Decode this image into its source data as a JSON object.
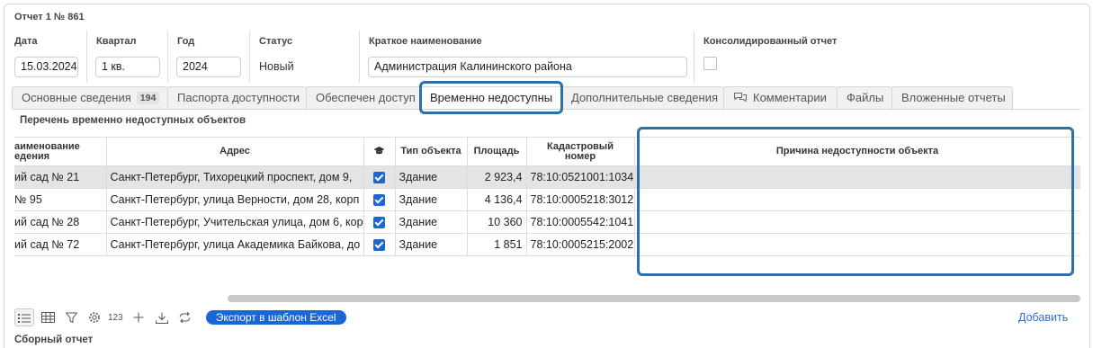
{
  "header": {
    "title": "Отчет 1 № 861",
    "fields": {
      "date_label": "Дата",
      "date_value": "15.03.2024",
      "quarter_label": "Квартал",
      "quarter_value": "1 кв.",
      "year_label": "Год",
      "year_value": "2024",
      "status_label": "Статус",
      "status_value": "Новый",
      "short_name_label": "Краткое наименование",
      "short_name_value": "Администрация Калининского района",
      "consolidated_label": "Консолидированный отчет"
    }
  },
  "tabs": [
    {
      "label": "Основные сведения",
      "badge": "194"
    },
    {
      "label": "Паспорта доступности"
    },
    {
      "label": "Обеспечен доступ"
    },
    {
      "label": "Временно недоступны",
      "active": true
    },
    {
      "label": "Дополнительные сведения"
    },
    {
      "label": "Комментарии",
      "icon": "comments-icon"
    },
    {
      "label": "Файлы"
    },
    {
      "label": "Вложенные отчеты"
    }
  ],
  "section": {
    "title": "Перечень временно недоступных объектов"
  },
  "table": {
    "columns": {
      "name_line1": "аименование",
      "name_line2": "едения",
      "address": "Адрес",
      "icon": "graduation-cap-icon",
      "object_type": "Тип объекта",
      "area": "Площадь",
      "cadastral_line1": "Кадастровый",
      "cadastral_line2": "номер",
      "reason": "Причина недоступности объекта"
    },
    "rows": [
      {
        "name": "ий сад № 21",
        "address": "Санкт-Петербург, Тихорецкий проспект, дом 9,",
        "checked": true,
        "type": "Здание",
        "area": "2 923,4",
        "cadastral": "78:10:0521001:1034",
        "reason": ""
      },
      {
        "name": "№ 95",
        "address": "Санкт-Петербург, улица Верности, дом 28, корп",
        "checked": true,
        "type": "Здание",
        "area": "4 136,4",
        "cadastral": "78:10:0005218:3012",
        "reason": ""
      },
      {
        "name": "ий сад № 28",
        "address": "Санкт-Петербург, Учительская улица, дом 6, кор",
        "checked": true,
        "type": "Здание",
        "area": "10 360",
        "cadastral": "78:10:0005542:1041",
        "reason": ""
      },
      {
        "name": "ий сад № 72",
        "address": "Санкт-Петербург, улица Академика Байкова, до",
        "checked": true,
        "type": "Здание",
        "area": "1 851",
        "cadastral": "78:10:0005215:2002",
        "reason": ""
      }
    ]
  },
  "toolbar": {
    "count_label": "123",
    "export_label": "Экспорт в шаблон Excel",
    "add_label": "Добавить"
  },
  "footer": {
    "summary_title": "Сборный отчет"
  },
  "colors": {
    "highlight": "#2f6fa8",
    "accent": "#1a66d6",
    "link": "#2a6fc9"
  }
}
